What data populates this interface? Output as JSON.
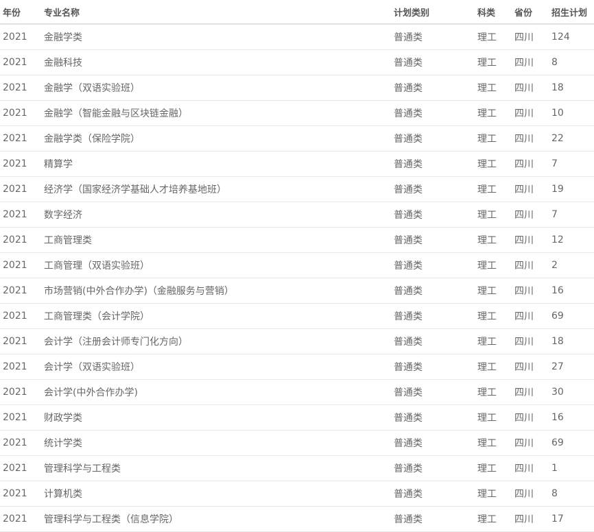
{
  "table": {
    "headers": [
      "年份",
      "专业名称",
      "计划类别",
      "科类",
      "省份",
      "招生计划"
    ],
    "rows": [
      [
        "2021",
        "金融学类",
        "普通类",
        "理工",
        "四川",
        "124"
      ],
      [
        "2021",
        "金融科技",
        "普通类",
        "理工",
        "四川",
        "8"
      ],
      [
        "2021",
        "金融学（双语实验班）",
        "普通类",
        "理工",
        "四川",
        "18"
      ],
      [
        "2021",
        "金融学（智能金融与区块链金融）",
        "普通类",
        "理工",
        "四川",
        "10"
      ],
      [
        "2021",
        "金融学类（保险学院）",
        "普通类",
        "理工",
        "四川",
        "22"
      ],
      [
        "2021",
        "精算学",
        "普通类",
        "理工",
        "四川",
        "7"
      ],
      [
        "2021",
        "经济学（国家经济学基础人才培养基地班）",
        "普通类",
        "理工",
        "四川",
        "19"
      ],
      [
        "2021",
        "数字经济",
        "普通类",
        "理工",
        "四川",
        "7"
      ],
      [
        "2021",
        "工商管理类",
        "普通类",
        "理工",
        "四川",
        "12"
      ],
      [
        "2021",
        "工商管理（双语实验班）",
        "普通类",
        "理工",
        "四川",
        "2"
      ],
      [
        "2021",
        "市场营销(中外合作办学)（金融服务与营销）",
        "普通类",
        "理工",
        "四川",
        "16"
      ],
      [
        "2021",
        "工商管理类（会计学院）",
        "普通类",
        "理工",
        "四川",
        "69"
      ],
      [
        "2021",
        "会计学（注册会计师专门化方向）",
        "普通类",
        "理工",
        "四川",
        "18"
      ],
      [
        "2021",
        "会计学（双语实验班）",
        "普通类",
        "理工",
        "四川",
        "27"
      ],
      [
        "2021",
        "会计学(中外合作办学)",
        "普通类",
        "理工",
        "四川",
        "30"
      ],
      [
        "2021",
        "财政学类",
        "普通类",
        "理工",
        "四川",
        "16"
      ],
      [
        "2021",
        "统计学类",
        "普通类",
        "理工",
        "四川",
        "69"
      ],
      [
        "2021",
        "管理科学与工程类",
        "普通类",
        "理工",
        "四川",
        "1"
      ],
      [
        "2021",
        "计算机类",
        "普通类",
        "理工",
        "四川",
        "8"
      ],
      [
        "2021",
        "管理科学与工程类（信息学院）",
        "普通类",
        "理工",
        "四川",
        "17"
      ]
    ]
  }
}
